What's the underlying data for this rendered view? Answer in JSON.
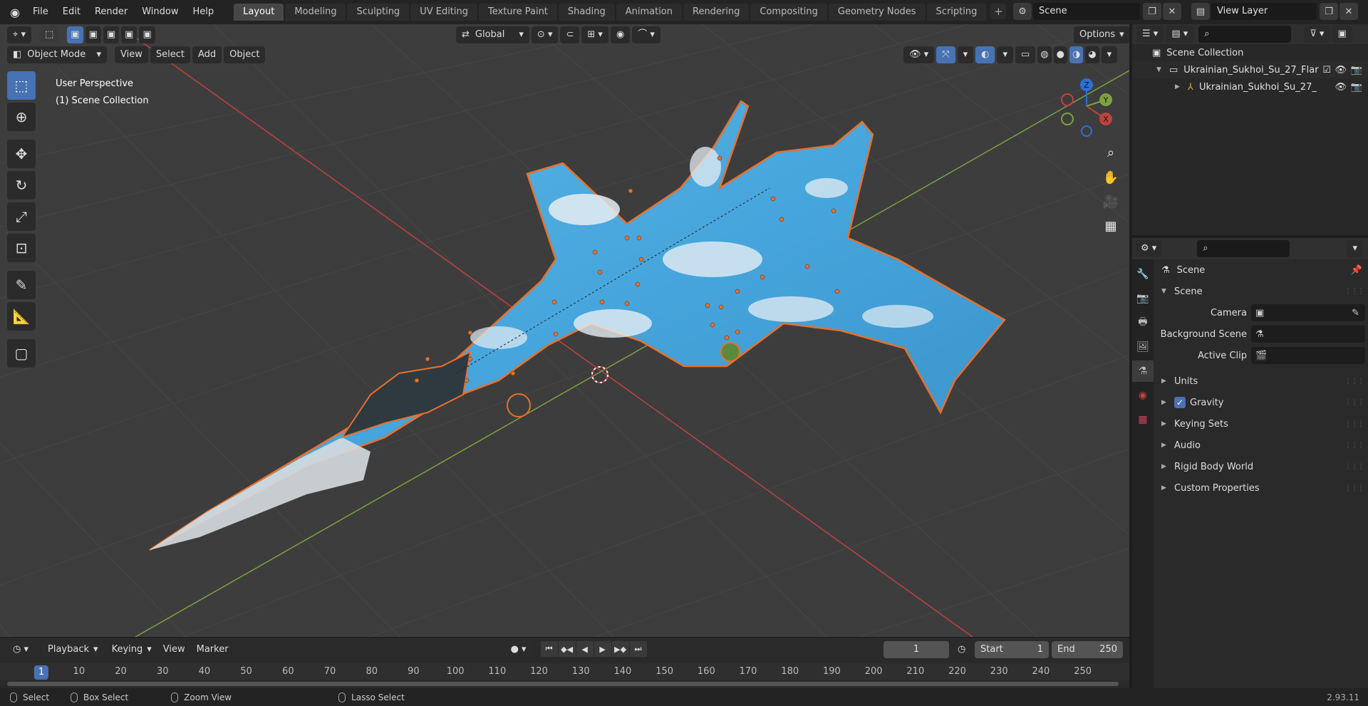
{
  "menu": [
    "File",
    "Edit",
    "Render",
    "Window",
    "Help"
  ],
  "workspaces": [
    "Layout",
    "Modeling",
    "Sculpting",
    "UV Editing",
    "Texture Paint",
    "Shading",
    "Animation",
    "Rendering",
    "Compositing",
    "Geometry Nodes",
    "Scripting"
  ],
  "active_workspace": "Layout",
  "scene_name": "Scene",
  "view_layer": "View Layer",
  "viewport": {
    "mode": "Object Mode",
    "menus": [
      "View",
      "Select",
      "Add",
      "Object"
    ],
    "transform_orientation": "Global",
    "options_label": "Options",
    "info_line1": "User Perspective",
    "info_line2": "(1) Scene Collection",
    "gizmo_axes": [
      "Z",
      "Y",
      "X"
    ]
  },
  "timeline": {
    "menus": [
      "Playback",
      "Keying",
      "View",
      "Marker"
    ],
    "current_frame": "1",
    "start_label": "Start",
    "start_value": "1",
    "end_label": "End",
    "end_value": "250",
    "ruler_current": "1",
    "ruler_ticks": [
      "10",
      "20",
      "30",
      "40",
      "50",
      "60",
      "70",
      "80",
      "90",
      "100",
      "110",
      "120",
      "130",
      "140",
      "150",
      "160",
      "170",
      "180",
      "190",
      "200",
      "210",
      "220",
      "230",
      "240",
      "250"
    ]
  },
  "statusbar": {
    "select": "Select",
    "box_select": "Box Select",
    "zoom_view": "Zoom View",
    "lasso_select": "Lasso Select",
    "version": "2.93.11"
  },
  "outliner": {
    "root": "Scene Collection",
    "collection": "Ukrainian_Sukhoi_Su_27_Flar",
    "object": "Ukrainian_Sukhoi_Su_27_"
  },
  "properties": {
    "context": "Scene",
    "panel_scene": "Scene",
    "camera_label": "Camera",
    "background_label": "Background Scene",
    "clip_label": "Active Clip",
    "panels": [
      "Units",
      "Gravity",
      "Keying Sets",
      "Audio",
      "Rigid Body World",
      "Custom Properties"
    ]
  },
  "colors": {
    "accent": "#4772b3",
    "selection_outline": "#e8702a",
    "grid_x_axis": "#c0413f",
    "grid_y_axis": "#7ba23f"
  }
}
